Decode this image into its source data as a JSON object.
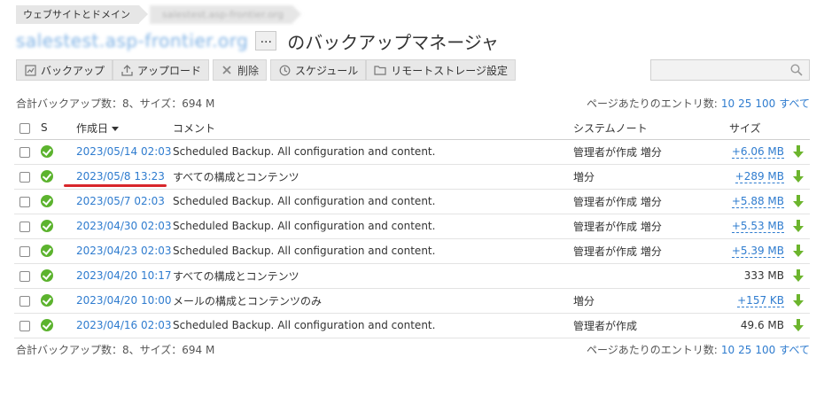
{
  "breadcrumb": [
    {
      "label": "ウェブサイトとドメイン"
    },
    {
      "label": "salestest.asp-frontier.org"
    }
  ],
  "header": {
    "domain": "salestest.asp-frontier.org",
    "more_label": "...",
    "title": "のバックアップマネージャ"
  },
  "toolbar": {
    "backup": "バックアップ",
    "upload": "アップロード",
    "delete": "削除",
    "schedule": "スケジュール",
    "remote": "リモートストレージ設定",
    "search_placeholder": ""
  },
  "summary": {
    "text": "合計バックアップ数：8、サイズ：694 M",
    "per_page_label": "ページあたりのエントリ数:",
    "options": [
      "10",
      "25",
      "100",
      "すべて"
    ]
  },
  "table": {
    "headers": {
      "status": "S",
      "date": "作成日",
      "comment": "コメント",
      "system_note": "システムノート",
      "size": "サイズ"
    },
    "rows": [
      {
        "date": "2023/05/14 02:03",
        "comment": "Scheduled Backup. All configuration and content.",
        "note": "管理者が作成 増分",
        "size": "+6.06 MB",
        "size_link": true
      },
      {
        "date": "2023/05/8 13:23",
        "comment": "すべての構成とコンテンツ",
        "note": "増分",
        "size": "+289 MB",
        "size_link": true
      },
      {
        "date": "2023/05/7 02:03",
        "comment": "Scheduled Backup. All configuration and content.",
        "note": "管理者が作成 増分",
        "size": "+5.88 MB",
        "size_link": true
      },
      {
        "date": "2023/04/30 02:03",
        "comment": "Scheduled Backup. All configuration and content.",
        "note": "管理者が作成 増分",
        "size": "+5.53 MB",
        "size_link": true
      },
      {
        "date": "2023/04/23 02:03",
        "comment": "Scheduled Backup. All configuration and content.",
        "note": "管理者が作成 増分",
        "size": "+5.39 MB",
        "size_link": true
      },
      {
        "date": "2023/04/20 10:17",
        "comment": "すべての構成とコンテンツ",
        "note": "",
        "size": "333 MB",
        "size_link": false
      },
      {
        "date": "2023/04/20 10:00",
        "comment": "メールの構成とコンテンツのみ",
        "note": "増分",
        "size": "+157 KB",
        "size_link": true
      },
      {
        "date": "2023/04/16 02:03",
        "comment": "Scheduled Backup. All configuration and content.",
        "note": "管理者が作成",
        "size": "49.6 MB",
        "size_link": false
      }
    ]
  },
  "colors": {
    "link": "#2f7ccf",
    "status_ok": "#5cb32e",
    "annotation": "#d8262b"
  }
}
